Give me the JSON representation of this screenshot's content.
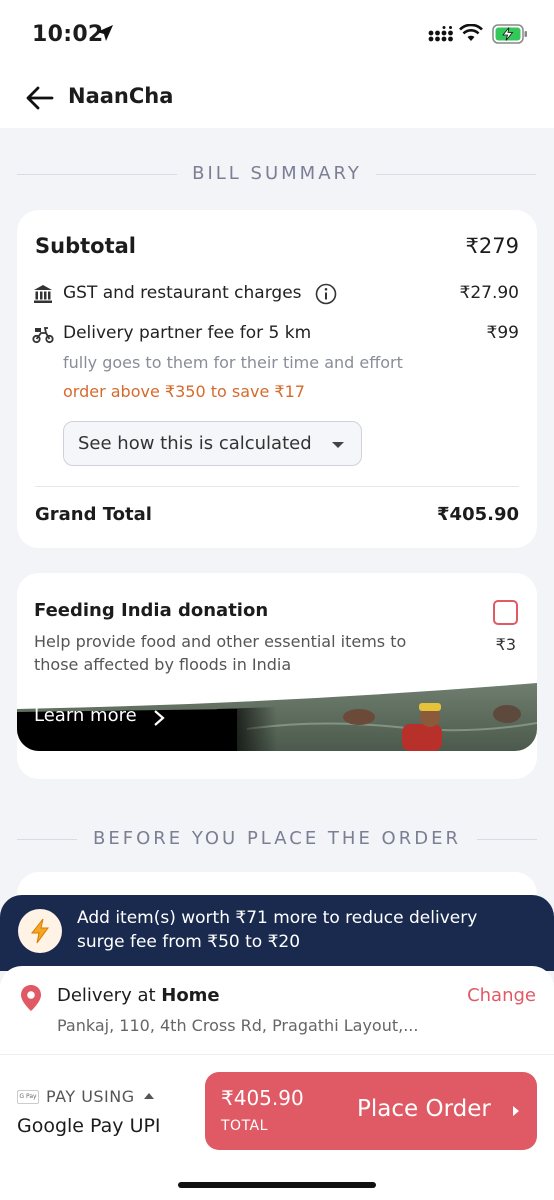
{
  "status_bar": {
    "time": "10:02"
  },
  "header": {
    "title": "NaanCha"
  },
  "bill_summary": {
    "section_title": "BILL SUMMARY",
    "subtotal_label": "Subtotal",
    "subtotal_value": "₹279",
    "gst_label": "GST and restaurant charges",
    "gst_value": "₹27.90",
    "delivery_label": "Delivery partner fee for 5 km",
    "delivery_value": "₹99",
    "delivery_note": "fully goes to them for their time and effort",
    "delivery_offer": "order above ₹350 to save ₹17",
    "calc_button_label": "See how this is calculated",
    "grand_total_label": "Grand Total",
    "grand_total_value": "₹405.90"
  },
  "donation": {
    "title": "Feeding India donation",
    "description_line1": "Help provide food and other essential items to",
    "description_line2": "those affected by floods in India",
    "amount": "₹3",
    "checked": false,
    "learn_more": "Learn more"
  },
  "before_order": {
    "section_title": "BEFORE YOU PLACE THE ORDER"
  },
  "surge_banner": {
    "line1": "Add item(s) worth ₹71 more to reduce delivery",
    "line2": "surge fee from ₹50 to ₹20"
  },
  "delivery": {
    "prefix": "Delivery at ",
    "place": "Home",
    "change_label": "Change",
    "address": "Pankaj, 110, 4th Cross Rd, Pragathi Layout,..."
  },
  "payment": {
    "gpay_badge": "G Pay",
    "pay_using_label": "PAY USING",
    "method": "Google Pay UPI",
    "total_amount": "₹405.90",
    "total_label": "TOTAL",
    "place_order_label": "Place Order"
  },
  "colors": {
    "accent_red": "#e05a66",
    "offer_orange": "#d66a2c",
    "banner_navy": "#1a2a4f"
  }
}
